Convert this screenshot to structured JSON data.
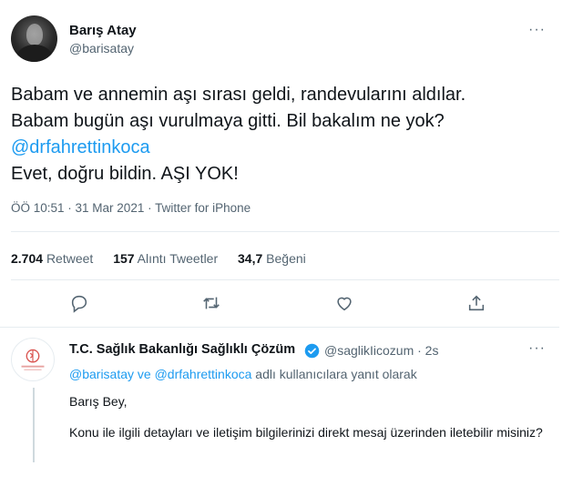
{
  "tweet": {
    "author_name": "Barış Atay",
    "author_handle": "@barisatay",
    "more_label": "···",
    "lines": [
      "Babam ve annemin aşı sırası geldi, randevularını aldılar.",
      "Babam bugün aşı vurulmaya gitti. Bil bakalım ne yok?",
      "@drfahrettinkoca",
      "Evet, doğru bildin. AŞI YOK!"
    ],
    "meta": "ÖÖ 10:51 · 31 Mar 2021 · Twitter for iPhone",
    "stats": {
      "retweet_count": "2.704",
      "retweet_label": "Retweet",
      "quote_count": "157",
      "quote_label": "Alıntı Tweetler",
      "like_count": "34,7",
      "like_label": "Beğeni"
    },
    "actions": [
      "reply-icon",
      "retweet-icon",
      "like-icon",
      "share-icon"
    ]
  },
  "reply": {
    "author_name": "T.C. Sağlık Bakanlığı Sağlıklı Çözüm",
    "author_handle": "@saglikIicozum · 2s",
    "more_label": "···",
    "replying_mentions": "@barisatay ve @drfahrettinkoca",
    "replying_suffix": " adlı kullanıcılara yanıt olarak",
    "text_1": "Barış Bey,",
    "text_2": "Konu ile ilgili detayları ve iletişim bilgilerinizi direkt mesaj üzerinden iletebilir misiniz?"
  },
  "colors": {
    "accent": "#1d9bf0",
    "secondary_text": "#536471",
    "border": "#e6ecf0"
  }
}
